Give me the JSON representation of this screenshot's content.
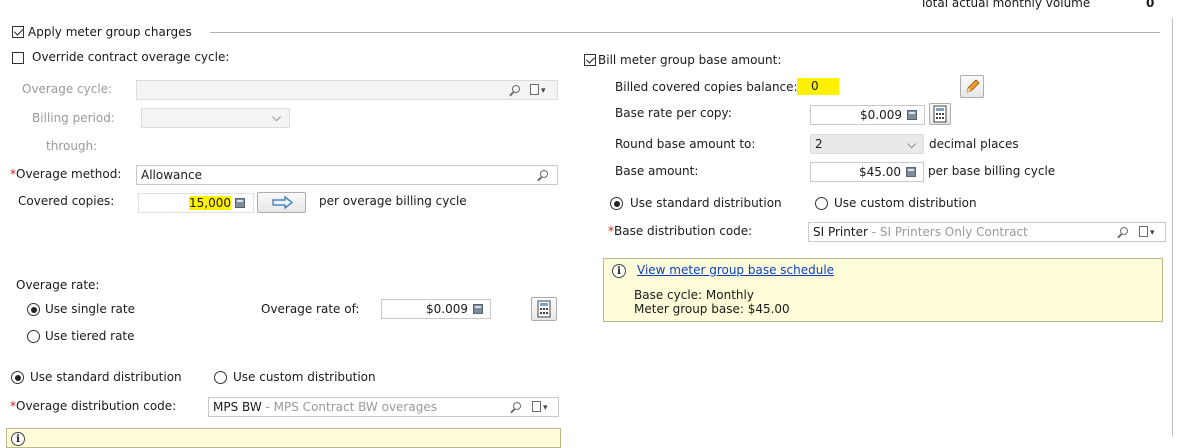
{
  "header": {
    "total_label": "Total actual monthly volume",
    "total_value": "0"
  },
  "apply_group": {
    "label": "Apply meter group charges",
    "checked": true
  },
  "left": {
    "override": {
      "label": "Override contract overage cycle:",
      "checked": false
    },
    "overage_cycle_label": "Overage cycle:",
    "overage_cycle_value": "",
    "billing_period_label": "Billing period:",
    "billing_period_value": "",
    "through_label": "through:",
    "overage_method_req": "*",
    "overage_method_label": "Overage method:",
    "overage_method_value": "Allowance",
    "covered_copies_label": "Covered copies:",
    "covered_copies_value": "15,000",
    "per_overage_label": "per overage billing cycle",
    "overage_rate_label": "Overage rate:",
    "single_rate_label": "Use single rate",
    "tiered_rate_label": "Use tiered rate",
    "rate_mode": "single",
    "overage_rate_of_label": "Overage rate of:",
    "overage_rate_value": "$0.009",
    "std_dist_label": "Use standard distribution",
    "custom_dist_label": "Use custom distribution",
    "distribution_mode": "standard",
    "overage_dist_req": "*",
    "overage_dist_label": "Overage distribution code:",
    "overage_dist_code": "MPS BW",
    "overage_dist_desc": " - MPS Contract BW overages"
  },
  "right": {
    "bill_base": {
      "label": "Bill meter group base amount:",
      "checked": true
    },
    "billed_balance_label": "Billed covered copies balance:",
    "billed_balance_value": "0",
    "base_rate_label": "Base rate per copy:",
    "base_rate_value": "$0.009",
    "round_label": "Round base amount to:",
    "round_value": "2",
    "decimal_label": "decimal places",
    "base_amount_label": "Base amount:",
    "base_amount_value": "$45.00",
    "per_base_label": "per base billing cycle",
    "std_dist_label": "Use standard distribution",
    "custom_dist_label": "Use custom distribution",
    "distribution_mode": "standard",
    "base_dist_req": "*",
    "base_dist_label": "Base distribution code:",
    "base_dist_code": "SI Printer",
    "base_dist_desc": " - SI Printers Only Contract",
    "info": {
      "link": "View meter group base schedule",
      "line1": "Base cycle: Monthly",
      "line2": "Meter group base: $45.00"
    }
  },
  "colors": {
    "highlight": "#fff200",
    "link": "#0b3fc7",
    "required": "#d02020",
    "info_bg": "#fffdd9"
  },
  "icons": [
    "magnifier-icon",
    "document-dropdown-icon",
    "calculator-icon",
    "arrow-right-icon",
    "pencil-icon",
    "info-icon",
    "chevron-down-icon"
  ]
}
